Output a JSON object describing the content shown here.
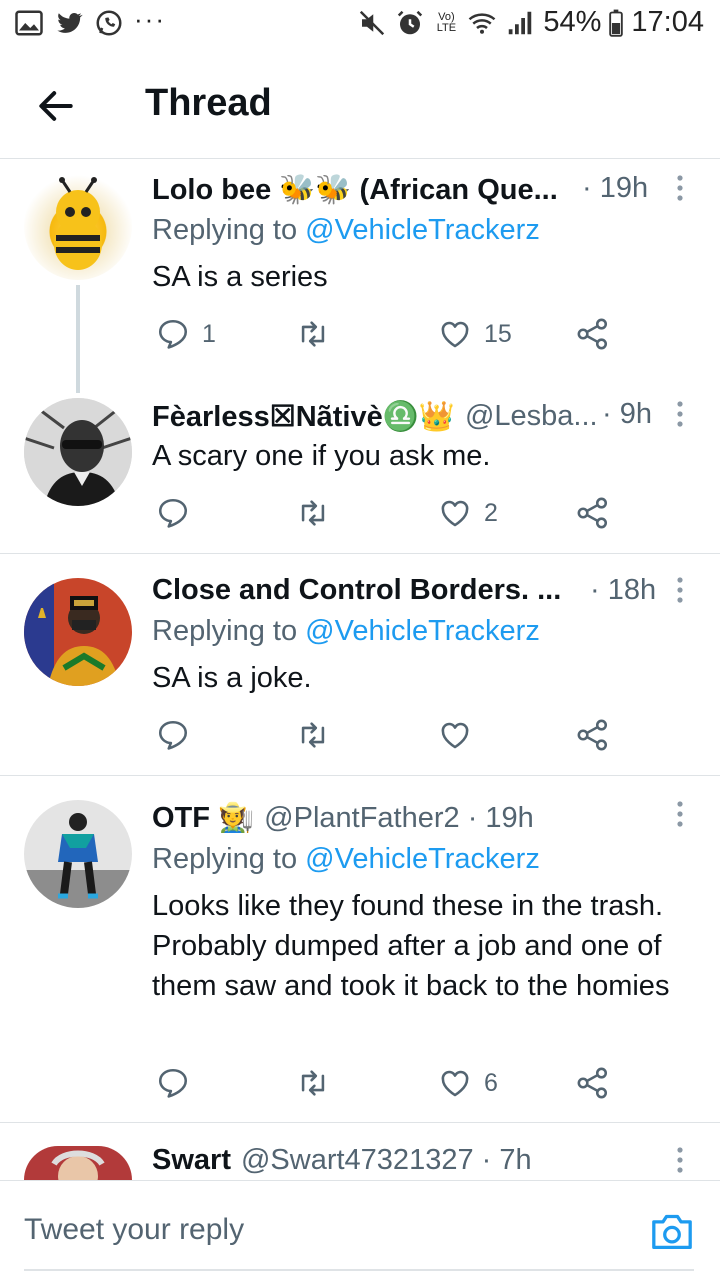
{
  "status_bar": {
    "battery": "54%",
    "time": "17:04",
    "volte": "Vo) LTE",
    "left_icons": [
      "gallery-icon",
      "twitter-icon",
      "whatsapp-icon",
      "more-dots-icon"
    ]
  },
  "header": {
    "title": "Thread"
  },
  "tweets": [
    {
      "name": "Lolo bee 🐝🐝 (African Que...",
      "handle": "",
      "time": "· 19h",
      "replying_prefix": "Replying to",
      "replying_to": "@VehicleTrackerz",
      "text": "SA is a series",
      "replies": "1",
      "retweets": "",
      "likes": "15"
    },
    {
      "name": "Fèarless☒Nãtivè♎👑",
      "handle": "@Lesba...",
      "time": "· 9h",
      "replying_prefix": "",
      "replying_to": "",
      "text": "A scary one if you ask me.",
      "replies": "",
      "retweets": "",
      "likes": "2"
    },
    {
      "name": "Close and Control Borders. ...",
      "handle": "",
      "time": "· 18h",
      "replying_prefix": "Replying to",
      "replying_to": "@VehicleTrackerz",
      "text": "SA is a joke.",
      "replies": "",
      "retweets": "",
      "likes": ""
    },
    {
      "name": "OTF 🧑‍🌾",
      "handle": "@PlantFather2 · 19h",
      "time": "",
      "replying_prefix": "Replying to",
      "replying_to": "@VehicleTrackerz",
      "text": "Looks like they found these in the trash. Probably dumped after a job and one of them saw and took it back to the homies",
      "replies": "",
      "retweets": "",
      "likes": "6"
    },
    {
      "name": "Swart",
      "handle": "@Swart47321327 · 7h",
      "time": "",
      "replying_prefix": "",
      "replying_to": "",
      "text": "",
      "replies": "",
      "retweets": "",
      "likes": ""
    }
  ],
  "compose": {
    "placeholder": "Tweet your reply"
  },
  "colors": {
    "accent": "#1d9bf0",
    "secondary_text": "#536471",
    "divider": "#dfe3e6"
  }
}
